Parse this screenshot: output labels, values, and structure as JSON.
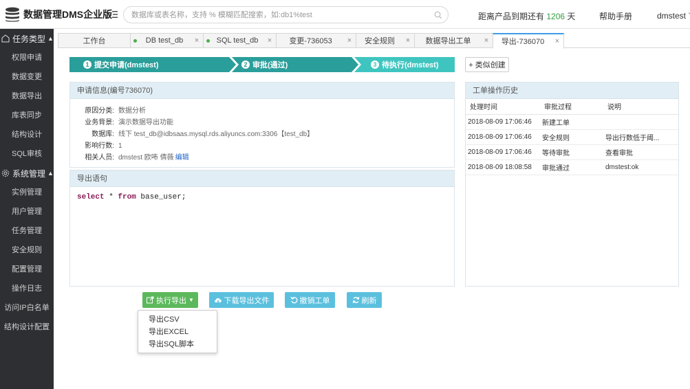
{
  "header": {
    "app_title": "数据管理DMS企业版",
    "search_placeholder": "数据库或表名称，支持 % 模糊匹配搜索，如:db1%test",
    "expire_prefix": "距离产品到期还有",
    "expire_days": "1206",
    "expire_suffix": "天",
    "help": "帮助手册",
    "user": "dmstest",
    "user_chevron": "﹀"
  },
  "sidebar": {
    "group1": {
      "label": "任务类型",
      "arrow": "▲",
      "icon": "task-icon"
    },
    "group1_items": [
      "权限申请",
      "数据变更",
      "数据导出",
      "库表同步",
      "结构设计",
      "SQL审核"
    ],
    "group2": {
      "label": "系统管理",
      "arrow": "▲",
      "icon": "gear-icon"
    },
    "group2_items": [
      "实例管理",
      "用户管理",
      "任务管理",
      "安全规则",
      "配置管理",
      "操作日志",
      "访问IP白名单",
      "结构设计配置"
    ]
  },
  "tabs": [
    {
      "label": "工作台",
      "dot": false,
      "close": false
    },
    {
      "label": "DB test_db",
      "dot": true,
      "close": true
    },
    {
      "label": "SQL test_db",
      "dot": true,
      "close": true
    },
    {
      "label": "变更-736053",
      "dot": false,
      "close": true
    },
    {
      "label": "安全规则",
      "dot": false,
      "close": true
    },
    {
      "label": "数据导出工单",
      "dot": false,
      "close": true
    },
    {
      "label": "导出-736070",
      "dot": false,
      "close": true,
      "active": true
    }
  ],
  "tab_close_glyph": "×",
  "steps": [
    {
      "num": "1",
      "label": "提交申请(dmstest)"
    },
    {
      "num": "2",
      "label": "审批(通过)"
    },
    {
      "num": "3",
      "label": "待执行(dmstest)"
    }
  ],
  "similar_button": "+ 类似创建",
  "apply_info": {
    "title": "申请信息(编号736070)",
    "rows": [
      {
        "label": "原因分类:",
        "value": "数据分析"
      },
      {
        "label": "业务背景:",
        "value": "演示数据导出功能"
      },
      {
        "label": "数据库:",
        "value": "线下 test_db@idbsaas.mysql.rds.aliyuncs.com:3306【test_db】"
      },
      {
        "label": "影响行数:",
        "value": "1"
      },
      {
        "label": "相关人员:",
        "value": "dmstest 欧咘 倩薇",
        "link": "编辑"
      }
    ]
  },
  "export_sql": {
    "title": "导出语句",
    "kw1": "select",
    "mid": " * ",
    "kw2": "from",
    "rest": " base_user;"
  },
  "history": {
    "title": "工单操作历史",
    "columns": [
      "处理时间",
      "审批过程",
      "说明"
    ],
    "rows": [
      {
        "time": "2018-08-09 17:06:46",
        "step": "新建工单",
        "note": ""
      },
      {
        "time": "2018-08-09 17:06:46",
        "step": "安全规则",
        "note": "导出行数低于阈..."
      },
      {
        "time": "2018-08-09 17:06:46",
        "step": "等待审批",
        "note": "查看审批",
        "note_link": true
      },
      {
        "time": "2018-08-09 18:08:58",
        "step": "审批通过",
        "note": "dmstest:ok",
        "step_green": true
      }
    ]
  },
  "actions": {
    "execute": "执行导出",
    "download": "下载导出文件",
    "cancel": "撤销工单",
    "refresh": "刷新"
  },
  "export_menu": [
    "导出CSV",
    "导出EXCEL",
    "导出SQL脚本"
  ],
  "colors": {
    "step_dark": "#2a9e9a",
    "step_light": "#3fc5c0",
    "sidebar_bg": "#2d2f33",
    "accent_blue": "#3d9be9"
  }
}
